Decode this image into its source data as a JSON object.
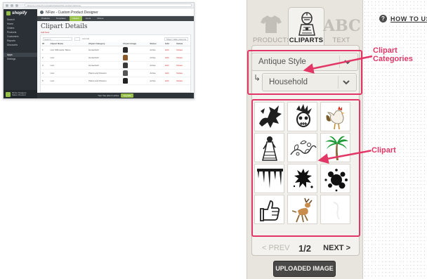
{
  "mini_screenshot": {
    "url": "nfizepd.myshopify.com/admin/apps/nfize-product-designer",
    "logo": "shopify",
    "sidebar": [
      "Search",
      "Home",
      "Orders",
      "Products",
      "Customers",
      "Reports",
      "Discounts",
      "Apps",
      "Settings"
    ],
    "active_item": "Apps",
    "footer_user": "NFize Designer",
    "footer_sub": "Sales Channel",
    "app_title": "NFize - Custom Product Designer",
    "tabs": [
      "Products",
      "Templates",
      "Cliparts",
      "Fonts",
      "Orders"
    ],
    "active_tab": "Cliparts",
    "page_title": "Clipart Details",
    "add_link": "Add New",
    "search_placeholder": "Search",
    "records_label": "records",
    "show_hide": "Show / Hide columns",
    "columns": [
      "ID",
      "Clipart Name",
      "Clipart Category",
      "Clipart Image",
      "Status",
      "Edit",
      "Delete"
    ],
    "rows": [
      {
        "id": "1",
        "name": "Lion Silhouette Tattoo",
        "category": "Household",
        "status": "Active",
        "edit": "Edit",
        "delete": "Delete"
      },
      {
        "id": "2",
        "name": "Lion",
        "category": "Household",
        "status": "Active",
        "edit": "Edit",
        "delete": "Delete"
      },
      {
        "id": "3",
        "name": "Lion",
        "category": "Household",
        "status": "Active",
        "edit": "Edit",
        "delete": "Delete"
      },
      {
        "id": "4",
        "name": "Lion",
        "category": "Plants and Flowers",
        "status": "Active",
        "edit": "Edit",
        "delete": "Delete"
      },
      {
        "id": "5",
        "name": "Lion",
        "category": "Plants and Flowers",
        "status": "Active",
        "edit": "Edit",
        "delete": "Delete"
      }
    ],
    "bottom_text": "Your free plan is active",
    "bottom_button": "Upgrade"
  },
  "designer": {
    "tabs": [
      {
        "label": "PRODUCTS",
        "icon": "tshirt-icon"
      },
      {
        "label": "CLIPARTS",
        "icon": "knight-icon"
      },
      {
        "label": "TEXT",
        "icon": "abc-icon",
        "glyph": "ABC"
      }
    ],
    "style_dropdown": "Antique Style",
    "category_dropdown": "Household",
    "elbow": "↳",
    "cliparts": [
      "dragon-clipart",
      "punk-skull-clipart",
      "rooster-clipart",
      "lady-clipart",
      "floral-swirl-clipart",
      "palm-tree-clipart",
      "paint-drips-clipart",
      "ink-splat-clipart",
      "paint-splatter-clipart",
      "thumbs-up-clipart",
      "cartoon-deer-clipart",
      "blank-clipart"
    ],
    "pager": {
      "prev": "< PREV",
      "page": "1/2",
      "next": "NEXT >"
    },
    "upload_label": "UPLOADED IMAGE"
  },
  "help": {
    "icon": "?",
    "label": "HOW TO USE"
  },
  "annotations": {
    "categories": [
      "Clipart",
      "Categories"
    ],
    "clipart": "Clipart",
    "color": "#e23766"
  }
}
